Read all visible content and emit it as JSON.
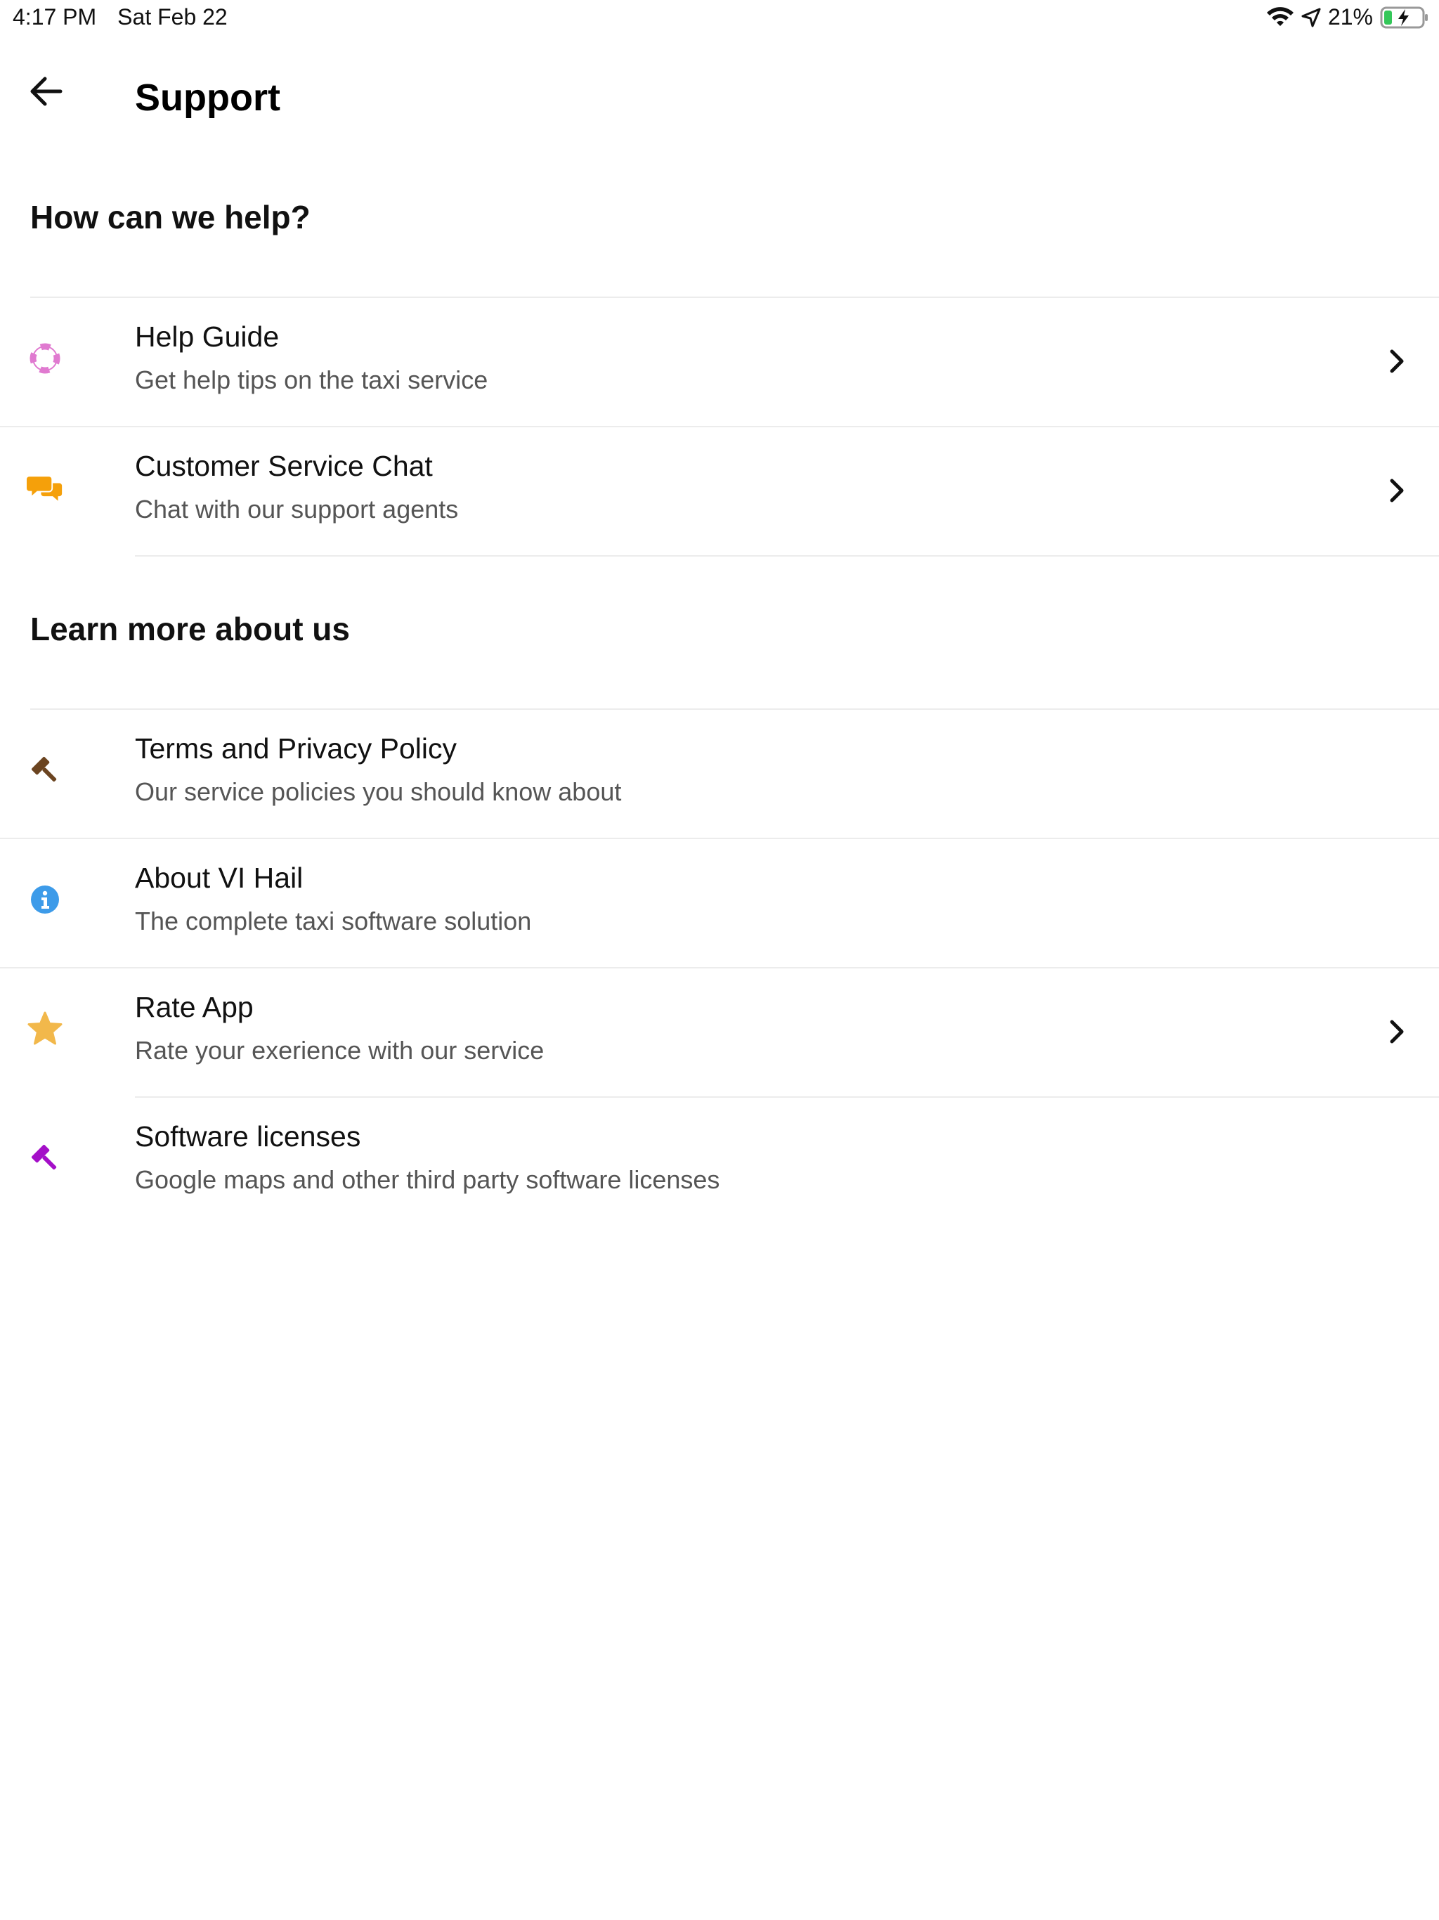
{
  "status_bar": {
    "time": "4:17 PM",
    "date": "Sat Feb 22",
    "battery_percent": "21%",
    "battery_level": 0.21
  },
  "header": {
    "title": "Support"
  },
  "sections": {
    "help": {
      "heading": "How can we help?",
      "items": [
        {
          "title": "Help Guide",
          "subtitle": "Get help tips on the taxi service",
          "icon": "lifebuoy-icon",
          "icon_color": "#e07ad0"
        },
        {
          "title": "Customer Service Chat",
          "subtitle": "Chat with our support agents",
          "icon": "chat-bubbles-icon",
          "icon_color": "#f5a00a"
        }
      ]
    },
    "about": {
      "heading": "Learn more about us",
      "items": [
        {
          "title": "Terms and Privacy Policy",
          "subtitle": "Our service policies you should know about",
          "icon": "gavel-icon",
          "icon_color": "#6b4420"
        },
        {
          "title": "About VI Hail",
          "subtitle": "The complete taxi software solution",
          "icon": "info-icon",
          "icon_color": "#3d9be9"
        },
        {
          "title": "Rate App",
          "subtitle": "Rate your exerience with our service",
          "icon": "star-icon",
          "icon_color": "#f2b84b"
        },
        {
          "title": "Software licenses",
          "subtitle": "Google maps and other third party software licenses",
          "icon": "gavel-icon",
          "icon_color": "#a40fc8"
        }
      ]
    }
  }
}
